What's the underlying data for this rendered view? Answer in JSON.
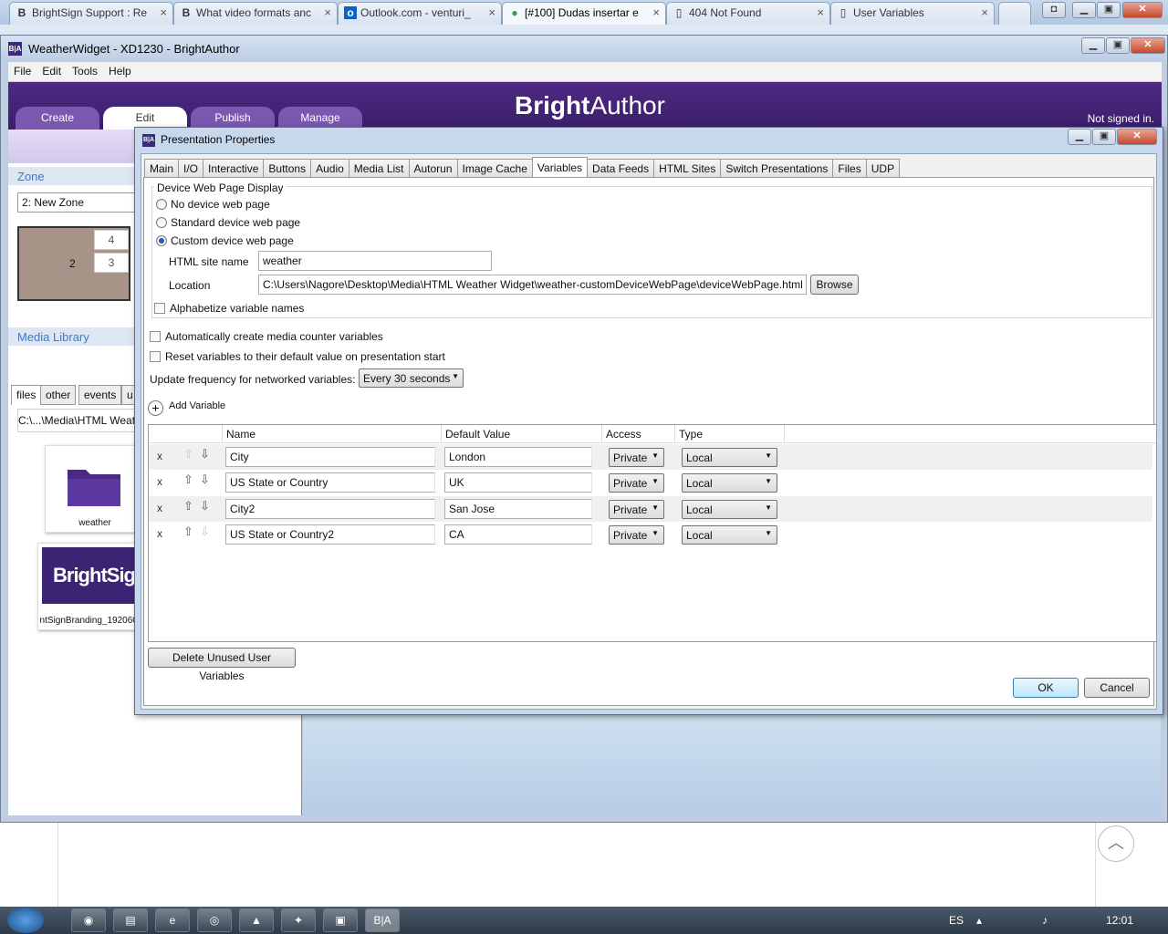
{
  "browser": {
    "tabs": [
      {
        "icon": "B",
        "title": "BrightSign Support : Re"
      },
      {
        "icon": "B",
        "title": "What video formats anc"
      },
      {
        "icon": "o",
        "title": "Outlook.com - venturi_"
      },
      {
        "icon": "●",
        "title": "[#100] Dudas insertar e"
      },
      {
        "icon": "▯",
        "title": "404 Not Found"
      },
      {
        "icon": "▯",
        "title": "User Variables"
      }
    ],
    "active_tab_index": 3
  },
  "app": {
    "title": "WeatherWidget - XD1230 - BrightAuthor",
    "menu": [
      "File",
      "Edit",
      "Tools",
      "Help"
    ],
    "brand_bold": "Bright",
    "brand_rest": "Author",
    "signed_status": "Not signed in.",
    "main_tabs": [
      "Create",
      "Edit",
      "Publish",
      "Manage"
    ],
    "active_main_tab": "Edit",
    "left": {
      "zone_header": "Zone",
      "zone_select": "2: New Zone",
      "zone_labels": {
        "z2": "2",
        "z3": "3",
        "z4": "4"
      },
      "media_header": "Media Library",
      "media_tabs": [
        "files",
        "other",
        "events",
        "u"
      ],
      "media_path": "C:\\...\\Media\\HTML Weat",
      "items": [
        {
          "caption": "weather",
          "icon": "folder-icon"
        },
        {
          "caption": "ntSignBranding_192060p",
          "logo_text": "BrightSign"
        }
      ]
    }
  },
  "dialog": {
    "title": "Presentation Properties",
    "tabs": [
      "Main",
      "I/O",
      "Interactive",
      "Buttons",
      "Audio",
      "Media List",
      "Autorun",
      "Image Cache",
      "Variables",
      "Data Feeds",
      "HTML Sites",
      "Switch Presentations",
      "Files",
      "UDP"
    ],
    "active_tab": "Variables",
    "device_web_page": {
      "legend": "Device Web Page Display",
      "options": [
        "No device web page",
        "Standard device web page",
        "Custom device web page"
      ],
      "selected_index": 2,
      "site_name_label": "HTML site name",
      "site_name_value": "weather",
      "location_label": "Location",
      "location_value": "C:\\Users\\Nagore\\Desktop\\Media\\HTML Weather Widget\\weather-customDeviceWebPage\\deviceWebPage.html",
      "browse_label": "Browse",
      "alphabetize_label": "Alphabetize variable names"
    },
    "auto_counter_label": "Automatically create media counter variables",
    "reset_label": "Reset variables to their default value on presentation start",
    "update_freq_label": "Update frequency for networked variables:",
    "update_freq_value": "Every 30 seconds",
    "add_variable_label": "Add Variable",
    "columns": [
      "Name",
      "Default Value",
      "Access",
      "Type"
    ],
    "variables": [
      {
        "name": "City",
        "default": "London",
        "access": "Private",
        "type": "Local"
      },
      {
        "name": "US State or Country",
        "default": "UK",
        "access": "Private",
        "type": "Local"
      },
      {
        "name": "City2",
        "default": "San Jose",
        "access": "Private",
        "type": "Local"
      },
      {
        "name": "US State or Country2",
        "default": "CA",
        "access": "Private",
        "type": "Local"
      }
    ],
    "delete_x": "x",
    "delete_unused_label": "Delete Unused User Variables",
    "ok_label": "OK",
    "cancel_label": "Cancel"
  },
  "taskbar": {
    "lang": "ES",
    "clock": "12:01"
  },
  "colors": {
    "brand_purple": "#3a1e6a",
    "selection_blue": "#1d5fb8"
  }
}
